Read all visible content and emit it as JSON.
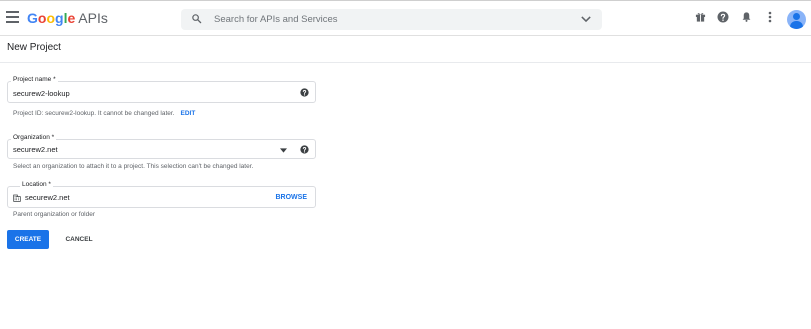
{
  "topbar": {
    "brand_letters": [
      "G",
      "o",
      "o",
      "g",
      "l",
      "e"
    ],
    "brand_suffix": "APIs",
    "search_placeholder": "Search for APIs and Services",
    "icons": [
      "gift-icon",
      "help-icon",
      "notifications-icon",
      "more-vert-icon",
      "account-avatar"
    ]
  },
  "page": {
    "title": "New Project"
  },
  "form": {
    "project_name": {
      "label": "Project name *",
      "value": "securew2-lookup",
      "helper": "Project ID: securew2-lookup. It cannot be changed later.",
      "edit_label": "EDIT"
    },
    "organization": {
      "label": "Organization *",
      "value": "securew2.net",
      "helper": "Select an organization to attach it to a project. This selection can't be changed later."
    },
    "location": {
      "label": "Location *",
      "value": "securew2.net",
      "browse_label": "BROWSE",
      "helper": "Parent organization or folder"
    }
  },
  "actions": {
    "create_label": "CREATE",
    "cancel_label": "CANCEL"
  },
  "colors": {
    "primary": "#1a73e8",
    "google_blue": "#4285f4",
    "google_red": "#ea4335",
    "google_yellow": "#fbbc05",
    "google_green": "#34a853",
    "icon_gray": "#5f6368"
  }
}
